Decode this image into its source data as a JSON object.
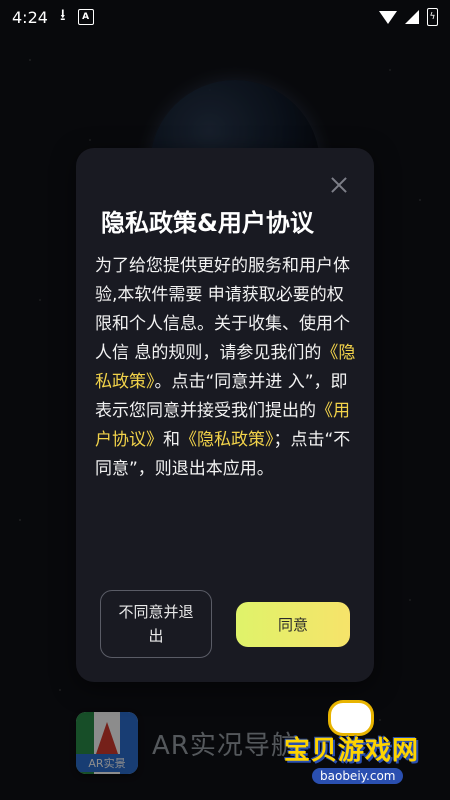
{
  "status_bar": {
    "time": "4:24",
    "badge_icon": "A"
  },
  "dialog": {
    "title": "隐私政策&用户协议",
    "body": {
      "t1": "为了给您提供更好的服务和用户体验,本软件需要 申请获取必要的权限和个人信息。关于收集、使用个人信 息的规则，请参见我们的",
      "link_privacy_1": "《隐私政策》",
      "t2": "。点击“同意并进 入”，即表示您同意并接受我们提出的",
      "link_user_agreement": "《用户协议》",
      "t3": "和",
      "link_privacy_2": "《隐私政策》",
      "t4": "；点击“不同意”，则退出本应用。"
    },
    "decline_label": "不同意并退出",
    "agree_label": "同意"
  },
  "background_app": {
    "icon_label": "AR实景",
    "name": "AR实况导航"
  },
  "watermark": {
    "title": "宝贝游戏网",
    "url": "baobeiy.com"
  },
  "colors": {
    "accent_link": "#f2d34a",
    "agree_gradient_start": "#dff36a",
    "agree_gradient_end": "#f6e36a"
  }
}
